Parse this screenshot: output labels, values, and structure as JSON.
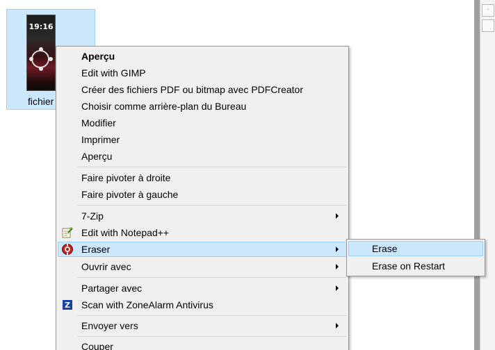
{
  "desktop": {
    "file": {
      "label": "fichier",
      "thumbnail": {
        "time": "19:16"
      }
    }
  },
  "context_menu": {
    "items": [
      {
        "label": "Aperçu",
        "bold": true
      },
      {
        "label": "Edit with GIMP"
      },
      {
        "label": "Créer des fichiers PDF ou bitmap avec PDFCreator"
      },
      {
        "label": "Choisir comme arrière-plan du Bureau"
      },
      {
        "label": "Modifier"
      },
      {
        "label": "Imprimer"
      },
      {
        "label": "Aperçu"
      },
      {
        "label": "Faire pivoter à droite"
      },
      {
        "label": "Faire pivoter à gauche"
      },
      {
        "label": "7-Zip",
        "submenu": true
      },
      {
        "label": "Edit with Notepad++",
        "icon": "notepad-plus-plus-icon"
      },
      {
        "label": "Eraser",
        "submenu": true,
        "highlighted": true,
        "icon": "eraser-icon"
      },
      {
        "label": "Ouvrir avec",
        "submenu": true
      },
      {
        "label": "Partager avec",
        "submenu": true
      },
      {
        "label": "Scan with ZoneAlarm Antivirus",
        "icon": "zonealarm-icon"
      },
      {
        "label": "Envoyer vers",
        "submenu": true
      },
      {
        "label": "Couper"
      }
    ]
  },
  "eraser_submenu": {
    "items": [
      {
        "label": "Erase",
        "highlighted": true
      },
      {
        "label": "Erase on Restart"
      }
    ]
  },
  "colors": {
    "menu_background": "#f0f0f0",
    "highlight_fill": "#cce8ff",
    "highlight_border": "#99d1ff",
    "menu_border": "#979797"
  }
}
